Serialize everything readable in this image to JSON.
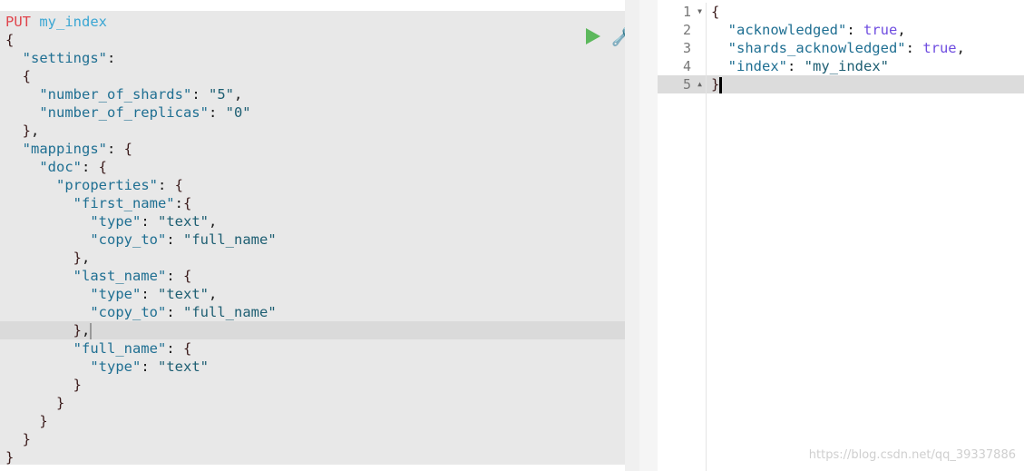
{
  "request": {
    "method": "PUT",
    "path": "my_index",
    "active_line": 18,
    "lines": [
      "{",
      "  \"settings\":",
      "  {",
      "    \"number_of_shards\": \"5\",",
      "    \"number_of_replicas\": \"0\"",
      "  },",
      "  \"mappings\": {",
      "    \"doc\": {",
      "      \"properties\": {",
      "        \"first_name\":{",
      "          \"type\": \"text\",",
      "          \"copy_to\": \"full_name\"",
      "        },",
      "        \"last_name\": {",
      "          \"type\": \"text\",",
      "          \"copy_to\": \"full_name\"",
      "        },",
      "        \"full_name\": {",
      "          \"type\": \"text\"",
      "        }",
      "      }",
      "    }",
      "  }",
      "}"
    ]
  },
  "actions": {
    "run": "play-icon",
    "settings": "wrench-icon"
  },
  "response": {
    "line_numbers": [
      "1",
      "2",
      "3",
      "4",
      "5"
    ],
    "lines": [
      "{",
      "  \"acknowledged\": true,",
      "  \"shards_acknowledged\": true,",
      "  \"index\": \"my_index\"",
      "}"
    ]
  },
  "watermark": "https://blog.csdn.net/qq_39337886"
}
